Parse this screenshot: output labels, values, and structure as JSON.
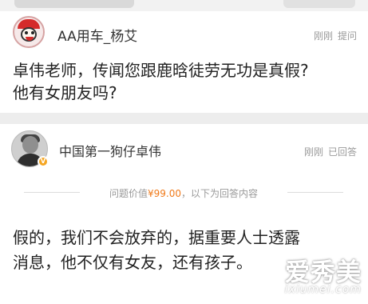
{
  "question": {
    "asker_name": "AA用车_杨艾",
    "time": "刚刚",
    "action": "提问",
    "lines": [
      "卓伟老师，传闻您跟鹿晗徒劳无功是真假?",
      "他有女朋友吗?"
    ]
  },
  "answer": {
    "answerer_name": "中国第一狗仔卓伟",
    "time": "刚刚",
    "action": "已回答",
    "verified_icon": "verified-badge-icon",
    "price_prefix": "问题价值",
    "price_amount": "¥99.00",
    "price_suffix": "，以下为回答内容",
    "lines": [
      "假的，我们不会放弃的，据重要人士透露",
      "消息，他不仅有女友，还有孩子。"
    ]
  },
  "watermark": {
    "main": "爱秀美",
    "sub": "ixiumei.com"
  },
  "colors": {
    "price_accent": "#f07a1a",
    "meta_text": "#9a9a9a",
    "divider_band": "#ededed",
    "verified_badge": "#f5a623"
  }
}
